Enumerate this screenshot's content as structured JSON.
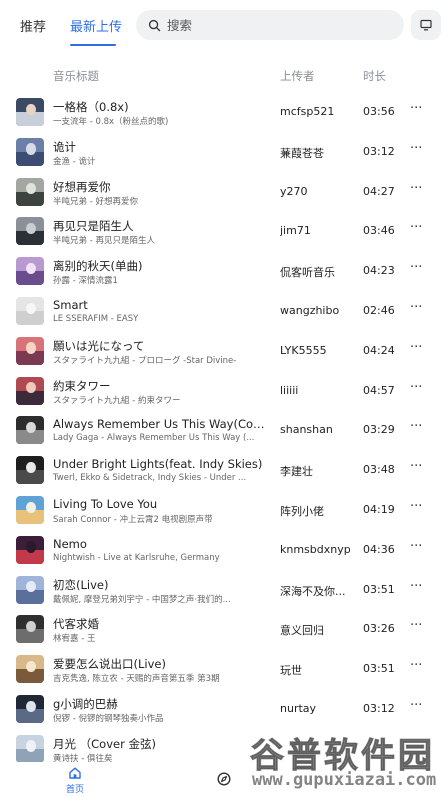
{
  "tabs": {
    "recommended": "推荐",
    "latest": "最新上传"
  },
  "search": {
    "placeholder": "搜索"
  },
  "columns": {
    "title": "音乐标题",
    "uploader": "上传者",
    "duration": "时长"
  },
  "songs": [
    {
      "title": "一格格（0.8x)",
      "subtitle": "一支流年 - 0.8x（粉丝点的歌)",
      "uploader": "mcfsp521",
      "duration": "03:56",
      "cover": [
        "#3b4a63",
        "#c8cfdb",
        "#e9d3c4"
      ]
    },
    {
      "title": "诡计",
      "subtitle": "金渔 - 诡计",
      "uploader": "蒹葭苍苍",
      "duration": "03:12",
      "cover": [
        "#6b7fa8",
        "#3c4d74",
        "#d8dce8"
      ]
    },
    {
      "title": "好想再爱你",
      "subtitle": "半吨兄弟 - 好想再爱你",
      "uploader": "y270",
      "duration": "04:27",
      "cover": [
        "#a3a7a2",
        "#3d4440",
        "#e0e3dd"
      ]
    },
    {
      "title": "再见只是陌生人",
      "subtitle": "半吨兄弟 - 再见只是陌生人",
      "uploader": "jim71",
      "duration": "03:46",
      "cover": [
        "#8a9099",
        "#2b3036",
        "#c9cdd3"
      ]
    },
    {
      "title": "离别的秋天(单曲)",
      "subtitle": "孙露 - 深情流露1",
      "uploader": "侃客听音乐",
      "duration": "04:23",
      "cover": [
        "#b89ad0",
        "#6a4d8c",
        "#efe3f5"
      ]
    },
    {
      "title": "Smart",
      "subtitle": "LE SSERAFIM - EASY",
      "uploader": "wangzhibo",
      "duration": "02:46",
      "cover": [
        "#e5e5e5",
        "#cfcfcf",
        "#f7f7f7"
      ]
    },
    {
      "title": "願いは光になって",
      "subtitle": "スタァライト九九組 - プロローグ -Star Divine-",
      "uploader": "LYK5555",
      "duration": "04:24",
      "cover": [
        "#d9737a",
        "#7b3a52",
        "#f5d6c4"
      ]
    },
    {
      "title": "約束タワー",
      "subtitle": "スタァライト九九組 - 約束タワー",
      "uploader": "liiiii",
      "duration": "04:57",
      "cover": [
        "#b04a52",
        "#3a2a3a",
        "#f2c9b8"
      ]
    },
    {
      "title": "Always Remember Us This Way(Compl...",
      "subtitle": "Lady Gaga - Always Remember Us This Way (...",
      "uploader": "shanshan",
      "duration": "03:29",
      "cover": [
        "#2d2d2d",
        "#8a8a8a",
        "#d9d9d9"
      ]
    },
    {
      "title": "Under Bright Lights(feat. Indy Skies)",
      "subtitle": "Twerl, Ekko & Sidetrack, Indy Skies - Under ...",
      "uploader": "李建壮",
      "duration": "03:48",
      "cover": [
        "#1e1e1e",
        "#4a4a4a",
        "#e8e8e8"
      ]
    },
    {
      "title": "Living To Love You",
      "subtitle": "Sarah Connor - 冲上云霄2 电视剧原声带",
      "uploader": "阵列小佬",
      "duration": "04:19",
      "cover": [
        "#5fa3d6",
        "#e8c27a",
        "#f3f0e6"
      ]
    },
    {
      "title": "Nemo",
      "subtitle": "Nightwish - Live at Karlsruhe,   Germany",
      "uploader": "knmsbdxnyp",
      "duration": "04:36",
      "cover": [
        "#3a1e3a",
        "#c23a4a",
        "#2a1a2a"
      ]
    },
    {
      "title": "初恋(Live)",
      "subtitle": "戴佩妮, 摩登兄弟刘宇宁 - 中国梦之声·我们的...",
      "uploader": "深海不及你...",
      "duration": "03:51",
      "cover": [
        "#9fb4d8",
        "#5a6f9a",
        "#e5ecf7"
      ]
    },
    {
      "title": "代客求婚",
      "subtitle": "林宥嘉 - 王",
      "uploader": "意义回归",
      "duration": "03:26",
      "cover": [
        "#2e2e2e",
        "#6d6d6d",
        "#cfcfcf"
      ]
    },
    {
      "title": "爱要怎么说出口(Live)",
      "subtitle": "吉克隽逸, 陈立农 - 天赐的声音第五季 第3期",
      "uploader": "玩世",
      "duration": "03:51",
      "cover": [
        "#d9b88a",
        "#7a5a3a",
        "#f4e6cf"
      ]
    },
    {
      "title": "g小调的巴赫",
      "subtitle": "倪锣 - 倪锣的钢琴独奏小作品",
      "uploader": "nurtay",
      "duration": "03:12",
      "cover": [
        "#202836",
        "#5a6a86",
        "#dfe4ec"
      ]
    },
    {
      "title": "月光 （Cover 金弦)",
      "subtitle": "黄诗扶 - 俱往矣",
      "uploader": "",
      "duration": "",
      "cover": [
        "#c7d3e0",
        "#8ea2b8",
        "#eef2f6"
      ]
    }
  ],
  "bottom_nav": {
    "home_label": "首页"
  },
  "watermark": {
    "text": "谷普软件园",
    "url": "www.gupuxiazai.com"
  },
  "colors": {
    "accent": "#2f6fe4",
    "muted": "#8a8f98"
  }
}
